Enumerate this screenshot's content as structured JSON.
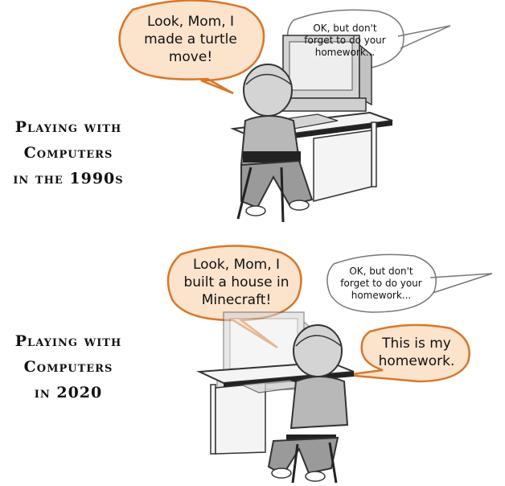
{
  "panels": [
    {
      "caption": [
        "Playing with",
        "Computers",
        "in the 1990s"
      ],
      "kid_bubble": [
        "Look, Mom, I",
        "made a turtle",
        "move!"
      ],
      "mom_bubble": [
        "OK, but don't",
        "forget to do your",
        "homework..."
      ]
    },
    {
      "caption": [
        "Playing with",
        "Computers",
        "in 2020"
      ],
      "kid_bubble": [
        "Look, Mom, I",
        "built a house in",
        "Minecraft!"
      ],
      "mom_bubble": [
        "OK, but don't",
        "forget to do your",
        "homework..."
      ],
      "reply_bubble": [
        "This is my",
        "homework."
      ]
    }
  ],
  "colors": {
    "kid_bubble_fill": "#fbe3cc",
    "kid_bubble_stroke": "#d9772a",
    "mom_bubble_fill": "#ffffff",
    "mom_bubble_stroke": "#777777",
    "figure_gray": "#d4d4d4",
    "figure_outline": "#333333"
  }
}
